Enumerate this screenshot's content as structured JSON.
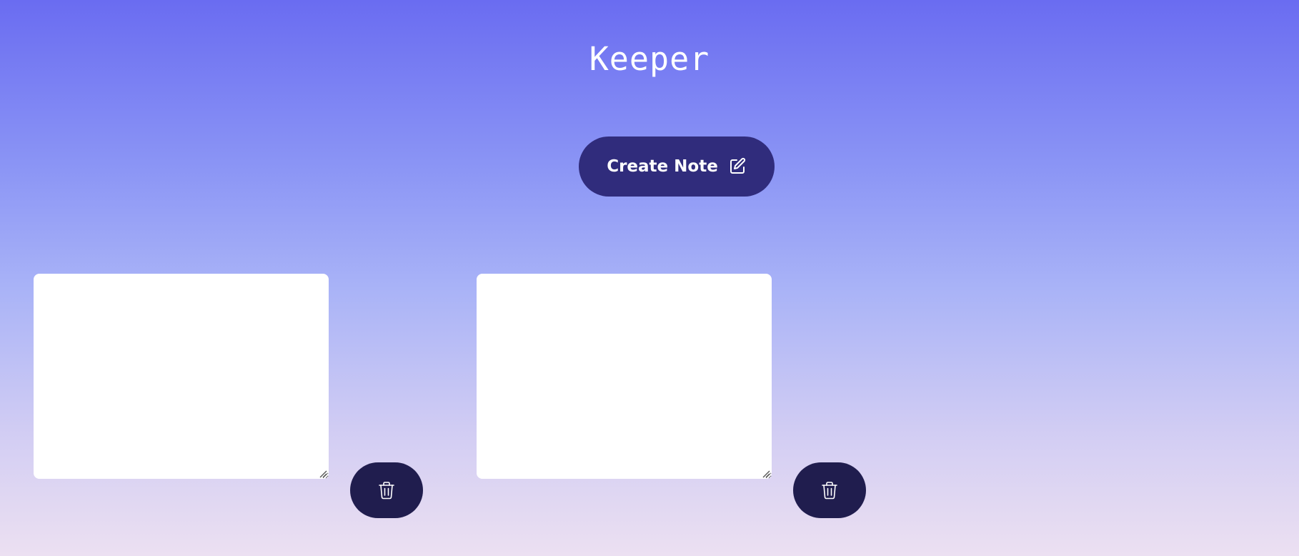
{
  "header": {
    "title": "Keeper"
  },
  "toolbar": {
    "create_label": "Create Note",
    "create_icon": "pencil-square-icon"
  },
  "notes": [
    {
      "value": "",
      "delete_icon": "trash-icon"
    },
    {
      "value": "",
      "delete_icon": "trash-icon"
    }
  ],
  "colors": {
    "background_top": "#6a6cf1",
    "background_bottom": "#ece0f2",
    "create_button": "#302c7c",
    "delete_button": "#201d4e",
    "note": "#ffffff"
  }
}
